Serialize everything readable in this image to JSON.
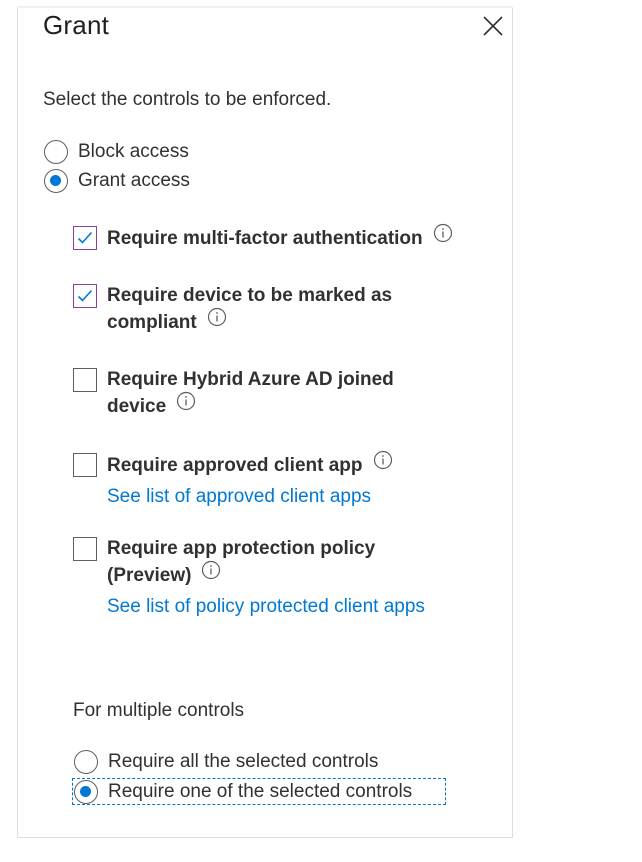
{
  "panel": {
    "title": "Grant",
    "subtitle": "Select the controls to be enforced."
  },
  "access": {
    "block_label": "Block access",
    "grant_label": "Grant access",
    "selected": "grant"
  },
  "controls": [
    {
      "line1": "Require multi-factor authentication",
      "line2": "",
      "checked": true
    },
    {
      "line1": "Require device to be marked as",
      "line2": "compliant",
      "checked": true
    },
    {
      "line1": "Require Hybrid Azure AD joined",
      "line2": "device",
      "checked": false
    },
    {
      "line1": "Require approved client app",
      "line2": "",
      "checked": false,
      "link": "See list of approved client apps"
    },
    {
      "line1": "Require app protection policy",
      "line2": "(Preview)",
      "checked": false,
      "link": "See list of policy protected client apps"
    }
  ],
  "multiple": {
    "label": "For multiple controls",
    "all_label": "Require all the selected controls",
    "one_label": "Require one of the selected controls",
    "selected": "one"
  },
  "colors": {
    "accent": "#0078d4",
    "checkbox_checked_border": "#8a3ea6",
    "text": "#323130"
  },
  "icons": {
    "close": "close-icon",
    "info": "info-icon",
    "checkmark": "checkmark-icon"
  }
}
